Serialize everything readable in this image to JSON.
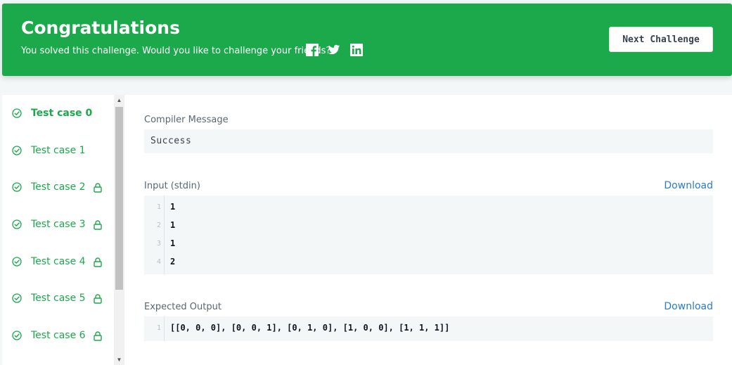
{
  "banner": {
    "title": "Congratulations",
    "subtitle": "You solved this challenge. Would you like to challenge your friends?",
    "next_button": "Next Challenge",
    "background": "#1ba94c",
    "social": [
      "facebook-icon",
      "twitter-icon",
      "linkedin-icon"
    ]
  },
  "sidebar": {
    "items": [
      {
        "label": "Test case 0",
        "active": true,
        "locked": false
      },
      {
        "label": "Test case 1",
        "active": false,
        "locked": false
      },
      {
        "label": "Test case 2",
        "active": false,
        "locked": true
      },
      {
        "label": "Test case 3",
        "active": false,
        "locked": true
      },
      {
        "label": "Test case 4",
        "active": false,
        "locked": true
      },
      {
        "label": "Test case 5",
        "active": false,
        "locked": true
      },
      {
        "label": "Test case 6",
        "active": false,
        "locked": true
      }
    ]
  },
  "main": {
    "compiler_label": "Compiler Message",
    "compiler_message": "Success",
    "input_label": "Input (stdin)",
    "input_download": "Download",
    "input_lines": [
      {
        "n": "1",
        "v": "1"
      },
      {
        "n": "2",
        "v": "1"
      },
      {
        "n": "3",
        "v": "1"
      },
      {
        "n": "4",
        "v": "2"
      }
    ],
    "expected_label": "Expected Output",
    "expected_download": "Download",
    "expected_lines": [
      {
        "n": "1",
        "v": "[[0, 0, 0], [0, 0, 1], [0, 1, 0], [1, 0, 0], [1, 1, 1]]"
      }
    ]
  },
  "colors": {
    "accent": "#1ba94c",
    "link": "#2a7dc4",
    "code_bg": "#f3f7f7"
  }
}
